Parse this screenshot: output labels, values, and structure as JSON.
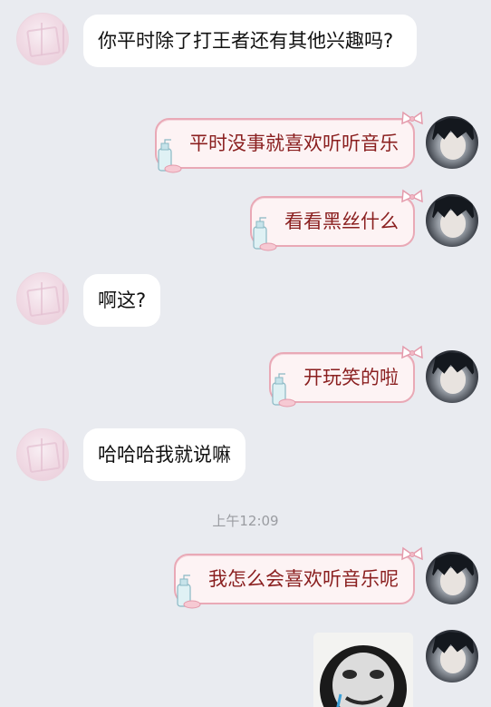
{
  "messages": [
    {
      "side": "left",
      "text": "你平时除了打王者还有其他兴趣吗?"
    },
    {
      "side": "right",
      "text": "平时没事就喜欢听听音乐"
    },
    {
      "side": "right",
      "text": "看看黑丝什么"
    },
    {
      "side": "left",
      "text": "啊这?"
    },
    {
      "side": "right",
      "text": "开玩笑的啦"
    },
    {
      "side": "left",
      "text": "哈哈哈我就说嘛"
    },
    {
      "side": "right",
      "text": "我怎么会喜欢听音乐呢"
    }
  ],
  "timestamp": "上午12:09",
  "sticker": {
    "icon": "meme-face-sticker"
  },
  "colors": {
    "background": "#e9ebf0",
    "right_bubble_border": "#e9a9b6",
    "right_text": "#8a1f1f"
  }
}
